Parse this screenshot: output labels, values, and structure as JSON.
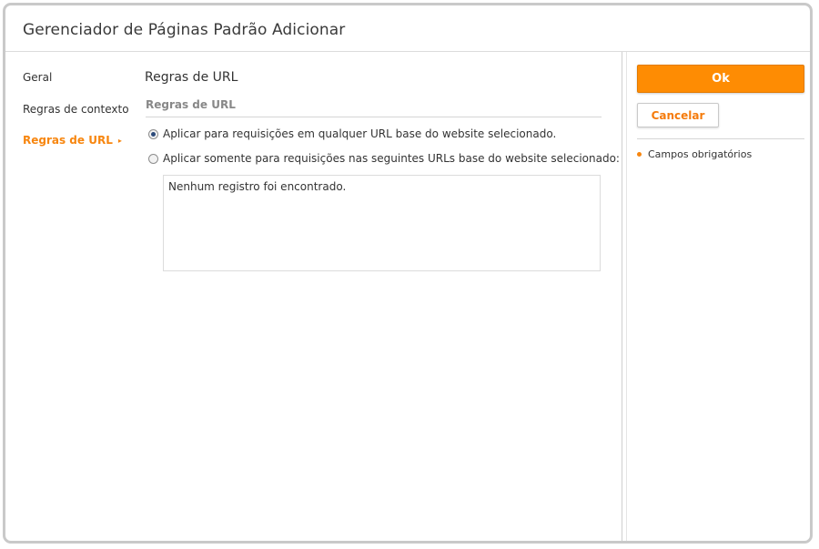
{
  "window": {
    "title": "Gerenciador de Páginas Padrão Adicionar"
  },
  "nav": {
    "items": [
      {
        "label": "Geral",
        "active": false
      },
      {
        "label": "Regras de contexto",
        "active": false
      },
      {
        "label": "Regras de URL",
        "active": true,
        "arrow": "▸"
      }
    ]
  },
  "main": {
    "section_title": "Regras de URL",
    "subsection_title": "Regras de URL",
    "radio_options": [
      {
        "label": "Aplicar para requisições em qualquer URL base do website selecionado.",
        "checked": true
      },
      {
        "label": "Aplicar somente para requisições nas seguintes URLs base do website selecionado:",
        "checked": false
      }
    ],
    "empty_message": "Nenhum registro foi encontrado."
  },
  "actions": {
    "ok_label": "Ok",
    "cancel_label": "Cancelar",
    "required_fields_label": "Campos obrigatórios"
  },
  "colors": {
    "accent": "#fe8c03",
    "accent_text": "#f7860f",
    "radio_dot": "#2c4a7a"
  }
}
